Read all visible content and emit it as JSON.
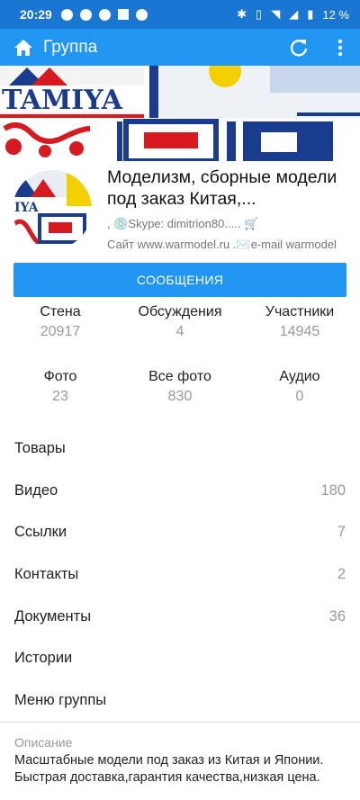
{
  "status_bar": {
    "time": "20:29",
    "battery": "12 %"
  },
  "app_bar": {
    "title": "Группа"
  },
  "cover": {
    "brand_text": "TAMIYA"
  },
  "group": {
    "name": "Моделизм, сборные модели под заказ Китая,...",
    "status": ", 💿Skype: dimitrion80..... 🛒",
    "site": "Сайт www.warmodel.ru .✉️e-mail warmodel"
  },
  "messages_button": {
    "label": "СООБЩЕНИЯ"
  },
  "counters": [
    {
      "label": "Стена",
      "value": "20917"
    },
    {
      "label": "Обсуждения",
      "value": "4"
    },
    {
      "label": "Участники",
      "value": "14945"
    },
    {
      "label": "Фото",
      "value": "23"
    },
    {
      "label": "Все фото",
      "value": "830"
    },
    {
      "label": "Аудио",
      "value": "0"
    }
  ],
  "sections": [
    {
      "label": "Товары",
      "count": ""
    },
    {
      "label": "Видео",
      "count": "180"
    },
    {
      "label": "Ссылки",
      "count": "7"
    },
    {
      "label": "Контакты",
      "count": "2"
    },
    {
      "label": "Документы",
      "count": "36"
    },
    {
      "label": "Истории",
      "count": ""
    },
    {
      "label": "Меню группы",
      "count": ""
    }
  ],
  "description": {
    "label": "Описание",
    "text": "Масштабные модели под заказ из Китая и Японии. Быстрая доставка,гарантия качества,низкая цена."
  },
  "colors": {
    "status_bar": "#1976d2",
    "app_bar": "#2196f3",
    "button": "#2196f3"
  }
}
